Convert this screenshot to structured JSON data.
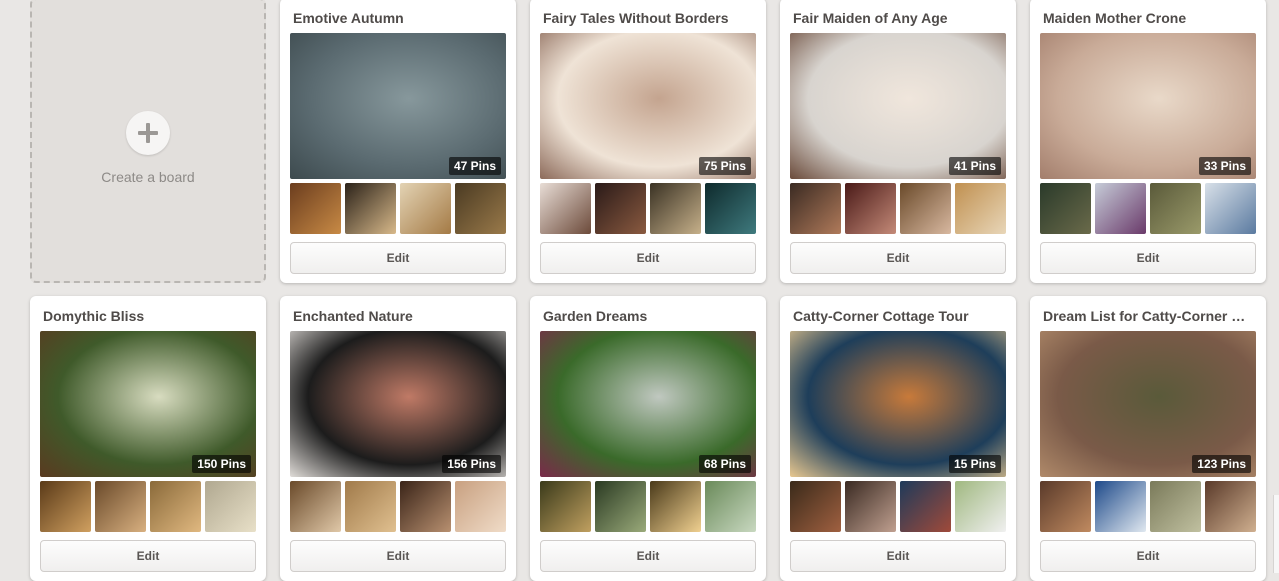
{
  "create_board": {
    "label": "Create a board",
    "icon": "plus-icon"
  },
  "edit_label": "Edit",
  "boards": [
    {
      "title": "Emotive Autumn",
      "pins": "47 Pins",
      "cover": [
        "#5a6a70",
        "#87989c",
        "#3d4a4e"
      ],
      "thumbs": [
        [
          "#6b3d1e",
          "#c88a45"
        ],
        [
          "#2b2219",
          "#d8b98a"
        ],
        [
          "#e3d3b4",
          "#a47a45"
        ],
        [
          "#4a3a22",
          "#9a7a4a"
        ]
      ]
    },
    {
      "title": "Fairy Tales Without Borders",
      "pins": "75 Pins",
      "cover": [
        "#efe3d6",
        "#c4a48f",
        "#8c6a5a"
      ],
      "thumbs": [
        [
          "#e8ddd6",
          "#6c4a3a"
        ],
        [
          "#2a1a18",
          "#8a5a40"
        ],
        [
          "#3a3224",
          "#c6b08a"
        ],
        [
          "#0e2a2c",
          "#3f7a7e"
        ]
      ]
    },
    {
      "title": "Fair Maiden of Any Age",
      "pins": "41 Pins",
      "cover": [
        "#d8d4cf",
        "#f0e6dc",
        "#6a4a3a"
      ],
      "thumbs": [
        [
          "#3a2a22",
          "#b07a5a"
        ],
        [
          "#4a1a18",
          "#c48a78"
        ],
        [
          "#6a4a2a",
          "#d8b8a0"
        ],
        [
          "#c09050",
          "#e8d6b8"
        ]
      ]
    },
    {
      "title": "Maiden Mother Crone",
      "pins": "33 Pins",
      "cover": [
        "#c9ab98",
        "#e9d9c9",
        "#a37e6c"
      ],
      "thumbs": [
        [
          "#2a3a2a",
          "#6a6a4a"
        ],
        [
          "#c6ccd8",
          "#6a3a6a"
        ],
        [
          "#5a5a3a",
          "#9a9a6a"
        ],
        [
          "#d8e0e8",
          "#5a7aa0"
        ]
      ]
    },
    {
      "title": "Domythic Bliss",
      "pins": "150 Pins",
      "cover": [
        "#3f5a2a",
        "#d8dcc0",
        "#5a3a20"
      ],
      "thumbs": [
        [
          "#5a3a18",
          "#d0a060"
        ],
        [
          "#6a4a2a",
          "#d8b080"
        ],
        [
          "#8a6a3a",
          "#e0b880"
        ],
        [
          "#b0a890",
          "#e8e0c8"
        ]
      ]
    },
    {
      "title": "Enchanted Nature",
      "pins": "156 Pins",
      "cover": [
        "#1c1c1c",
        "#c07a66",
        "#e0dcd8"
      ],
      "thumbs": [
        [
          "#6a4a2a",
          "#e0c8a8"
        ],
        [
          "#a07a4a",
          "#e0c090"
        ],
        [
          "#3a2418",
          "#b89070"
        ],
        [
          "#c8a080",
          "#f0dcc8"
        ]
      ]
    },
    {
      "title": "Garden Dreams",
      "pins": "68 Pins",
      "cover": [
        "#3a6a2a",
        "#c0c8c0",
        "#7a2a4a"
      ],
      "thumbs": [
        [
          "#3a3a1a",
          "#c0a060"
        ],
        [
          "#2a3a22",
          "#9aaa7a"
        ],
        [
          "#4a3a1a",
          "#f0d090"
        ],
        [
          "#6a8a5a",
          "#c8d8c0"
        ]
      ]
    },
    {
      "title": "Catty-Corner Cottage Tour",
      "pins": "15 Pins",
      "cover": [
        "#1e3e5a",
        "#c87a3a",
        "#e8c890"
      ],
      "thumbs": [
        [
          "#3a2a1a",
          "#a06040"
        ],
        [
          "#3a2a22",
          "#c0a090"
        ],
        [
          "#1e3a5a",
          "#a04a3a"
        ],
        [
          "#a0b880",
          "#f0f0f0"
        ]
      ]
    },
    {
      "title": "Dream List for Catty-Corner Cottage",
      "pins": "123 Pins",
      "cover": [
        "#7a5a48",
        "#5a5a3a",
        "#b08a6a"
      ],
      "thumbs": [
        [
          "#5a3a2a",
          "#c08a60"
        ],
        [
          "#1e4a8a",
          "#e0e8f0"
        ],
        [
          "#7a7a5a",
          "#c0c0a0"
        ],
        [
          "#5a3a2a",
          "#d0b090"
        ]
      ]
    }
  ]
}
